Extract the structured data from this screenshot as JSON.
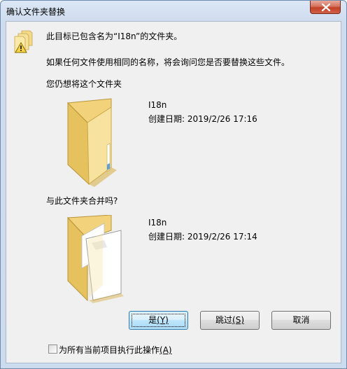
{
  "window": {
    "title": "确认文件夹替换"
  },
  "message": {
    "line1": "此目标已包含名为“I18n”的文件夹。",
    "line2": "如果任何文件使用相同的名称，将会询问您是否要替换这些文件。",
    "prompt": "您仍想将这个文件夹"
  },
  "existing_folder": {
    "name": "I18n",
    "created": "创建日期: 2019/2/26 17:16"
  },
  "merge_prompt": "与此文件夹合并吗?",
  "new_folder": {
    "name": "I18n",
    "created": "创建日期: 2019/2/26 17:14"
  },
  "buttons": {
    "yes": "是",
    "yes_key": "(Y)",
    "skip": "跳过",
    "skip_key": "(S)",
    "cancel": "取消"
  },
  "apply_all": {
    "label": "为所有当前项目执行此操作",
    "key": "(A)",
    "checked": false
  },
  "icons": {
    "warning": "folder-warning-icon",
    "close": "close-icon"
  }
}
